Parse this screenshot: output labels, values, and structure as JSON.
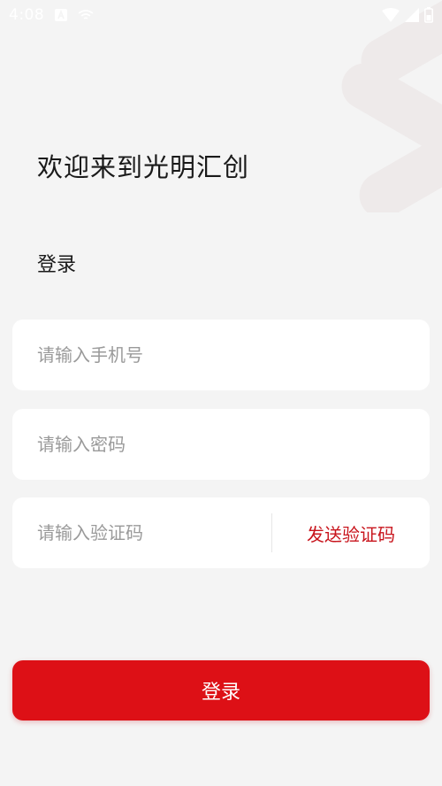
{
  "status_bar": {
    "time": "4:08",
    "icons": [
      "notification-a-icon",
      "cast-icon",
      "wifi-icon",
      "cellular-icon",
      "battery-icon"
    ]
  },
  "header": {
    "title": "欢迎来到光明汇创"
  },
  "login_form": {
    "section_label": "登录",
    "phone_placeholder": "请输入手机号",
    "password_placeholder": "请输入密码",
    "code_placeholder": "请输入验证码",
    "send_code_label": "发送验证码",
    "submit_label": "登录"
  },
  "colors": {
    "accent": "#dd1016",
    "link": "#c8141c",
    "background": "#f4f4f4"
  }
}
